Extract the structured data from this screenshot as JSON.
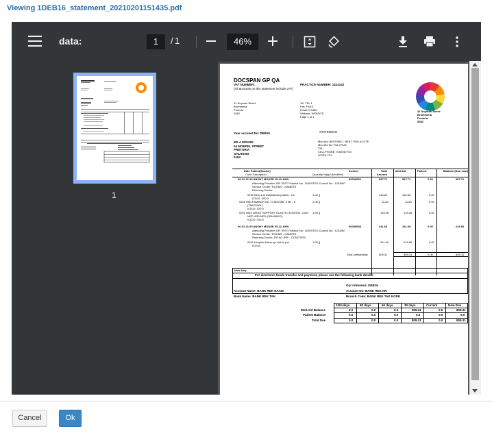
{
  "window": {
    "title": "Viewing 1DEB16_statement_20210201151435.pdf"
  },
  "toolbar": {
    "doc_name": "data:",
    "page_current": "1",
    "page_separator": "/",
    "page_total": "1",
    "zoom": "46%",
    "icons": [
      "menu-icon",
      "zoom-out-icon",
      "zoom-in-icon",
      "fit-page-icon",
      "rotate-icon",
      "download-icon",
      "print-icon",
      "more-icon"
    ]
  },
  "sidebar": {
    "thumbnail_label": "1"
  },
  "doc": {
    "practice": "DOCSPAN GP QA",
    "vat_number": "VAT NUMBER: .",
    "practice_number": "PRACTICE NUMBER: 1414142",
    "vat_note": "(All amounts on this statement include VAT)",
    "addr": [
      "31 Snyman Street",
      "Brummeria",
      "Pretoria",
      "0082"
    ],
    "contact": [
      "Tel: TEL 1",
      "Fax: FAKS",
      "Email: E-MAIL",
      "Website: WEBSITE",
      "Page 1 of 1"
    ],
    "right_addr": [
      "31 Snyman Street",
      "Brummeria",
      "Pretoria",
      "0082"
    ],
    "account_no": "Your account No: DEB16",
    "statement": "STATEMENT",
    "patient_addr": [
      "MS A MOUSE",
      "44 MOEPEL STREET",
      "PRETORIA",
      "GAUTENG",
      "0184"
    ],
    "med_info": [
      "Med Aid: BESTMED - BEAT TWO ACUTE",
      "Med Aid No: FULLPAID",
      "TEL:",
      "CELLPHONE: 0762067704",
      "WORK TEL:"
    ],
    "table_headers": [
      "Date Patient(Doctor)",
      "Code Description",
      "Quantity Nappi (Modifier)",
      "Invoice",
      "Total Amount",
      "Med Aid",
      "Patient",
      "Balance (Non cost)"
    ],
    "visits": [
      {
        "line": "06-01-21 00 ANONY MOUSE 25-12-1969",
        "invoice": "00000050",
        "total": "567.71",
        "medaid": "567.71",
        "patient": "0.00",
        "balance": "567.71",
        "notes": [
          "Attending Provider: DR TEST Practice No.: DOKSTED Council No.: 1234567",
          "Service Center: ROOMS - KAMERS",
          "Referring Doctor:"
        ],
        "items": [
          {
            "code": "0190 New and established patient - Co",
            "qty": "1.00 []",
            "total": "416.60",
            "medaid": "416.60",
            "patient": "0.00"
          },
          {
            "code": "ICD10: Z00.0",
            "qty": "",
            "total": "",
            "medaid": "",
            "patient": ""
          },
          {
            "code": "0201 PAN FAMIBOR INJ 75 MG/SML 3 ML - 6",
            "qty": "2.00 []",
            "total": "11.83",
            "medaid": "11.83",
            "patient": "0.00"
          },
          {
            "code": "(786111001)",
            "qty": "",
            "total": "",
            "medaid": "",
            "patient": ""
          },
          {
            "code": "ICD10: Z00.0",
            "qty": "",
            "total": "",
            "medaid": "",
            "patient": ""
          },
          {
            "code": "0201 0810 WRIST SUPPORT ELASTIC 901WT04. CDM",
            "qty": "1.00 []",
            "total": "139.28",
            "medaid": "139.28",
            "patient": "0.00"
          },
          {
            "code": "MED WELNED (000498020)",
            "qty": "",
            "total": "",
            "medaid": "",
            "patient": ""
          },
          {
            "code": "ICD10: Z00.0",
            "qty": "",
            "total": "",
            "medaid": "",
            "patient": ""
          }
        ]
      },
      {
        "line": "06-01-21 00 ANONY MOUSE 25-12-1969",
        "invoice": "00000058",
        "total": "241.60",
        "medaid": "241.60",
        "patient": "0.00",
        "balance": "241.60",
        "notes": [
          "Attending Provider: DR TEST Practice No.: DOKSTED Council No.: 1234567",
          "Service Center: ROOMS - KAMERS",
          "Referring Doctor: DR NO REF - DONOTEDI"
        ],
        "items": [
          {
            "code": "0109 Hospital follow-up visit to pat",
            "qty": "1.00 []",
            "total": "241.60",
            "medaid": "241.60",
            "patient": "0.00"
          },
          {
            "code": "ICD10:",
            "qty": "",
            "total": "",
            "medaid": "",
            "patient": ""
          }
        ]
      }
    ],
    "total_outstanding_label": "Total outstanding:",
    "total_outstanding": "809.31",
    "total_medaid": "809.31",
    "total_patient": "0.00",
    "total_balance": "809.31",
    "note_key": "Note Key:",
    "eft_line": "For electronic funds transfer and payment, please use the following bank details:",
    "our_reference": "Our reference: DEB16",
    "account_name": "Account Name: BANK REK NAAM",
    "account_number": "Account No: BANK REK NR",
    "bank_name": "Bank Name: BANK REK TAK",
    "branch_code": "Branch Code: BANK REK TAK KODE",
    "aging_headers": [
      "120+days",
      "90 days",
      "60 days",
      "30 days",
      "Current",
      "Now Due"
    ],
    "aging_rows": [
      {
        "label": "Med.Aid Balance",
        "values": [
          "0.0",
          "0.0",
          "0.0",
          "809.31",
          "0.0",
          "809.31"
        ]
      },
      {
        "label": "Patient Balance",
        "values": [
          "0.0",
          "0.0",
          "0.0",
          "0.0",
          "0.0",
          "0.0"
        ]
      },
      {
        "label": "Total Due",
        "values": [
          "0.0",
          "0.0",
          "0.0",
          "809.31",
          "0.0",
          "809.31"
        ]
      }
    ]
  },
  "footer": {
    "cancel_label": "Cancel",
    "ok_label": "Ok"
  },
  "colors": {
    "toolbar_bg": "#323639",
    "viewer_bg": "#525659",
    "ok_button": "#3a87c6",
    "title": "#2b6ea5",
    "thumb_highlight": "#8ab4f8"
  }
}
